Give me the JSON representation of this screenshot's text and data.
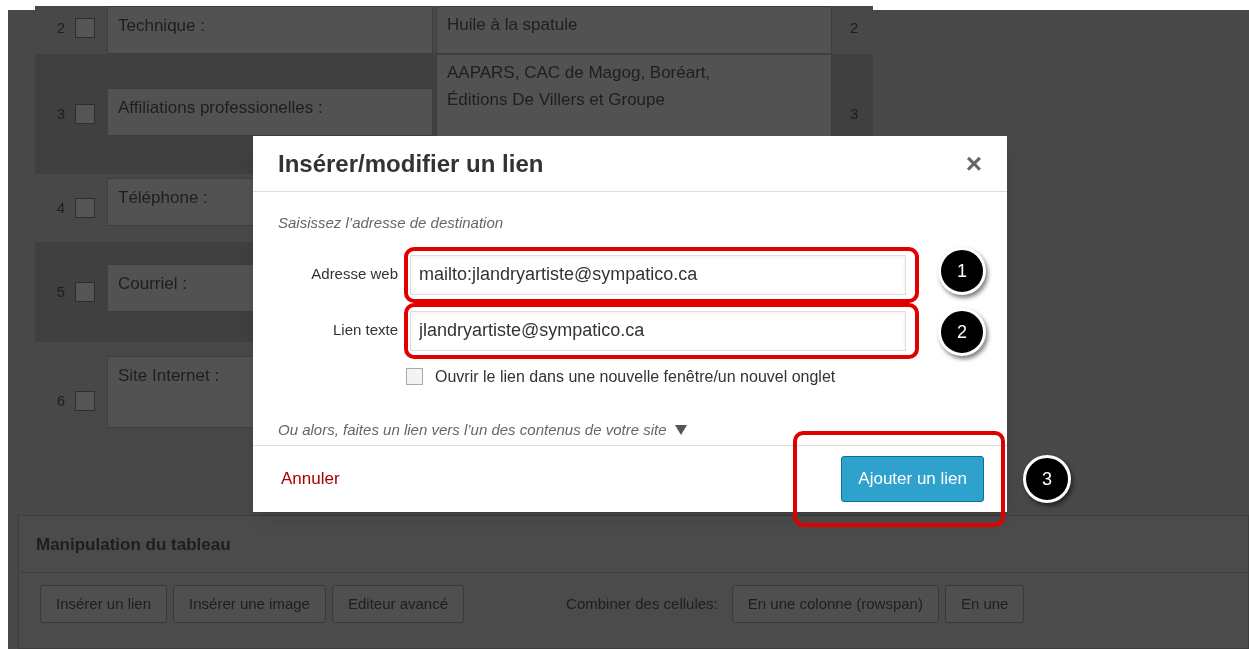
{
  "table_rows": [
    {
      "number": "2",
      "checked": false,
      "label": "Technique :",
      "value": [
        "Huile à la spatule"
      ],
      "count": "2"
    },
    {
      "number": "3",
      "checked": false,
      "label": "Affiliations professionelles :",
      "value": [
        "AAPARS, CAC de Magog, Boréart,",
        "Éditions De Villers et Groupe"
      ],
      "count": "3"
    },
    {
      "number": "4",
      "checked": false,
      "label": "Téléphone :",
      "value": []
    },
    {
      "number": "5",
      "checked": false,
      "label": "Courriel :",
      "value": []
    },
    {
      "number": "6",
      "checked": false,
      "label": "Site Internet :",
      "value": []
    }
  ],
  "panel": {
    "title": "Manipulation du tableau",
    "buttons": [
      "Insérer un lien",
      "Insérer une image",
      "Editeur avancé"
    ],
    "combine_label": "Combiner des cellules:",
    "combine_buttons": [
      "En une colonne (rowspan)",
      "En une"
    ]
  },
  "dialog": {
    "title": "Insérer/modifier un lien",
    "close": "×",
    "intro": "Saisissez l’adresse de destination",
    "fields": [
      {
        "label": "Adresse web",
        "value": "mailto:jlandryartiste@sympatico.ca"
      },
      {
        "label": "Lien texte",
        "value": "jlandryartiste@sympatico.ca"
      }
    ],
    "new_window": {
      "label": "Ouvrir le lien dans une nouvelle fenêtre/un nouvel onglet",
      "checked": false
    },
    "existing_content": "Ou alors, faites un lien vers l’un des contenus de votre site",
    "cancel": "Annuler",
    "submit": "Ajouter un lien"
  },
  "annotations": [
    "1",
    "2",
    "3"
  ]
}
